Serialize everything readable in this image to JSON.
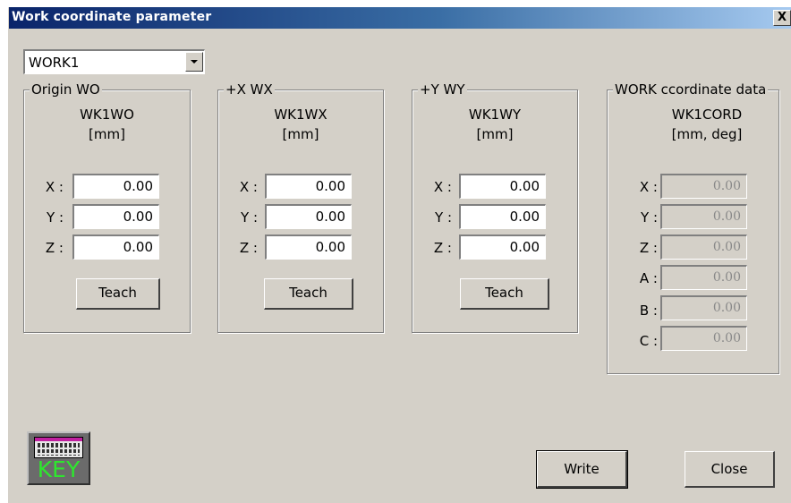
{
  "window": {
    "title": "Work coordinate parameter",
    "close_glyph": "X"
  },
  "work_select": {
    "value": "WORK1"
  },
  "groups": {
    "origin": {
      "legend": "Origin WO",
      "name": "WK1WO",
      "unit": "[mm]",
      "teach_label": "Teach",
      "fields": [
        {
          "axis": "X :",
          "value": "0.00"
        },
        {
          "axis": "Y :",
          "value": "0.00"
        },
        {
          "axis": "Z :",
          "value": "0.00"
        }
      ]
    },
    "plus_x": {
      "legend": "+X WX",
      "name": "WK1WX",
      "unit": "[mm]",
      "teach_label": "Teach",
      "fields": [
        {
          "axis": "X :",
          "value": "0.00"
        },
        {
          "axis": "Y :",
          "value": "0.00"
        },
        {
          "axis": "Z :",
          "value": "0.00"
        }
      ]
    },
    "plus_y": {
      "legend": "+Y WY",
      "name": "WK1WY",
      "unit": "[mm]",
      "teach_label": "Teach",
      "fields": [
        {
          "axis": "X :",
          "value": "0.00"
        },
        {
          "axis": "Y :",
          "value": "0.00"
        },
        {
          "axis": "Z :",
          "value": "0.00"
        }
      ]
    },
    "cord": {
      "legend": "WORK ccordinate data",
      "name": "WK1CORD",
      "unit": "[mm, deg]",
      "fields": [
        {
          "axis": "X :",
          "value": "0.00"
        },
        {
          "axis": "Y :",
          "value": "0.00"
        },
        {
          "axis": "Z :",
          "value": "0.00"
        },
        {
          "axis": "A :",
          "value": "0.00"
        },
        {
          "axis": "B :",
          "value": "0.00"
        },
        {
          "axis": "C :",
          "value": "0.00"
        }
      ]
    }
  },
  "key_button": {
    "label": "KEY"
  },
  "actions": {
    "write_label": "Write",
    "close_label": "Close"
  }
}
